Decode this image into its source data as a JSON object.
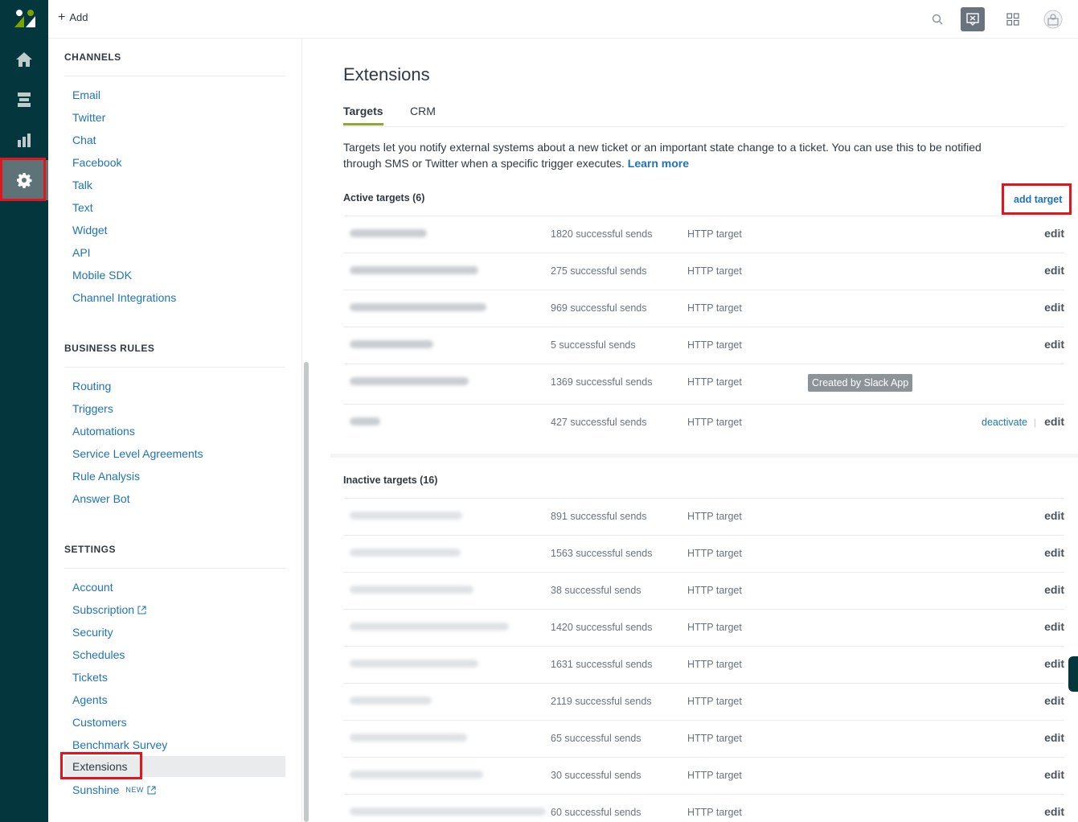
{
  "topbar": {
    "add_label": "Add"
  },
  "rail": {
    "icons": [
      "zendesk-logo",
      "home-icon",
      "views-icon",
      "reporting-icon",
      "admin-gear-icon"
    ]
  },
  "nav": {
    "channels": {
      "title": "CHANNELS",
      "items": [
        "Email",
        "Twitter",
        "Chat",
        "Facebook",
        "Talk",
        "Text",
        "Widget",
        "API",
        "Mobile SDK",
        "Channel Integrations"
      ]
    },
    "business_rules": {
      "title": "BUSINESS RULES",
      "items": [
        "Routing",
        "Triggers",
        "Automations",
        "Service Level Agreements",
        "Rule Analysis",
        "Answer Bot"
      ]
    },
    "settings": {
      "title": "SETTINGS",
      "items": [
        "Account",
        "Subscription",
        "Security",
        "Schedules",
        "Tickets",
        "Agents",
        "Customers",
        "Benchmark Survey",
        "Extensions",
        "Sunshine"
      ],
      "new_badge": "NEW"
    }
  },
  "main": {
    "title": "Extensions",
    "tabs": [
      "Targets",
      "CRM"
    ],
    "description": "Targets let you notify external systems about a new ticket or an important state change to a ticket. You can use this to be notified through SMS or Twitter when a specific trigger executes.",
    "learn_more": "Learn more",
    "active_title": "Active targets (6)",
    "add_target": "add target",
    "inactive_title": "Inactive targets (16)",
    "edit_label": "edit",
    "deactivate_label": "deactivate",
    "active_targets": [
      {
        "sends": "1820 successful sends",
        "type": "HTTP target"
      },
      {
        "sends": "275 successful sends",
        "type": "HTTP target"
      },
      {
        "sends": "969 successful sends",
        "type": "HTTP target"
      },
      {
        "sends": "5 successful sends",
        "type": "HTTP target"
      },
      {
        "sends": "1369 successful sends",
        "type": "HTTP target",
        "badge": "Created by Slack App"
      },
      {
        "sends": "427 successful sends",
        "type": "HTTP target"
      }
    ],
    "inactive_targets": [
      {
        "sends": "891 successful sends",
        "type": "HTTP target"
      },
      {
        "sends": "1563 successful sends",
        "type": "HTTP target"
      },
      {
        "sends": "38 successful sends",
        "type": "HTTP target"
      },
      {
        "sends": "1420 successful sends",
        "type": "HTTP target"
      },
      {
        "sends": "1631 successful sends",
        "type": "HTTP target"
      },
      {
        "sends": "2119 successful sends",
        "type": "HTTP target"
      },
      {
        "sends": "65 successful sends",
        "type": "HTTP target"
      },
      {
        "sends": "30 successful sends",
        "type": "HTTP target"
      },
      {
        "sends": "60 successful sends",
        "type": "HTTP target"
      }
    ]
  },
  "colors": {
    "rail": "#03363d",
    "link": "#1f73b7",
    "tab_accent": "#8fa833",
    "highlight": "#e3151c"
  }
}
